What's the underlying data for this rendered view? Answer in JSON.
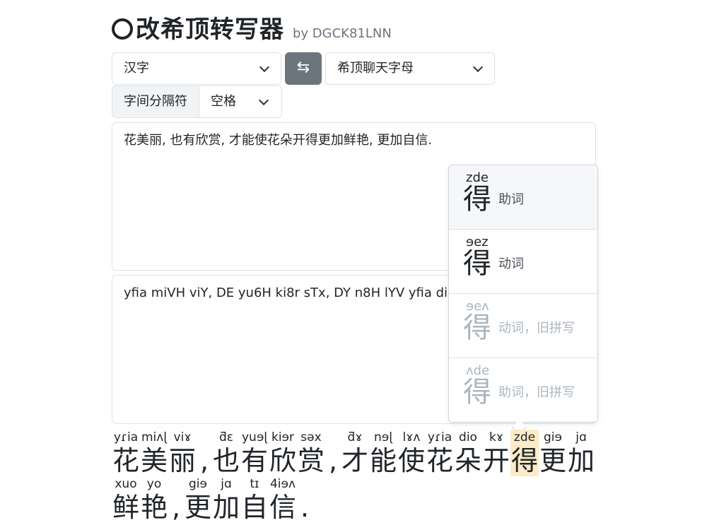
{
  "header": {
    "title": "改希顶转写器",
    "byline": "by DGCK81LNN"
  },
  "controls": {
    "source": "汉字",
    "swap_icon": "⇆",
    "target": "希顶聊天字母",
    "separator_label": "字间分隔符",
    "separator_value": "空格"
  },
  "input_text": "花美丽, 也有欣赏, 才能使花朵开得更加鲜艳, 更加自信.",
  "output_text": "yfia miVH viY, DE yu6H ki8r sTx, DY n8H lYV yfia dio gi8 ja t1 4i8V.",
  "popover": {
    "options": [
      {
        "anno": "zde",
        "char": "得",
        "desc": "助词"
      },
      {
        "anno": "ɘez",
        "char": "得",
        "desc": "动词"
      },
      {
        "anno": "ɘeʌ",
        "char": "得",
        "desc": "动词，旧拼写"
      },
      {
        "anno": "ʌde",
        "char": "得",
        "desc": "助词，旧拼写"
      }
    ]
  },
  "ruby": {
    "line1": [
      {
        "r": "yɾia",
        "c": "花"
      },
      {
        "r": "miʌɭ",
        "c": "美"
      },
      {
        "r": "viɤ",
        "c": "丽"
      },
      {
        "r": "",
        "c": ","
      },
      {
        "r": "ƌɛ",
        "c": "也"
      },
      {
        "r": "yuɘɭ",
        "c": "有"
      },
      {
        "r": "kiɘr",
        "c": "欣"
      },
      {
        "r": "səx",
        "c": "赏"
      },
      {
        "r": "",
        "c": ","
      },
      {
        "r": "ƌɤ",
        "c": "才"
      },
      {
        "r": "nɘɭ",
        "c": "能"
      },
      {
        "r": "lɤʌ",
        "c": "使"
      },
      {
        "r": "yɾia",
        "c": "花"
      },
      {
        "r": "dio",
        "c": "朵"
      },
      {
        "r": "kɤ",
        "c": "开"
      },
      {
        "r": "zde",
        "c": "得"
      },
      {
        "r": "giɘ",
        "c": "更"
      },
      {
        "r": "jɑ",
        "c": "加"
      }
    ],
    "line2": [
      {
        "r": "xuo",
        "c": "鲜"
      },
      {
        "r": "yo",
        "c": "艳"
      },
      {
        "r": "",
        "c": ","
      },
      {
        "r": "giɘ",
        "c": "更"
      },
      {
        "r": "jɑ",
        "c": "加"
      },
      {
        "r": "tɪ",
        "c": "自"
      },
      {
        "r": "4iɘʌ",
        "c": "信"
      },
      {
        "r": "",
        "c": "."
      }
    ]
  }
}
